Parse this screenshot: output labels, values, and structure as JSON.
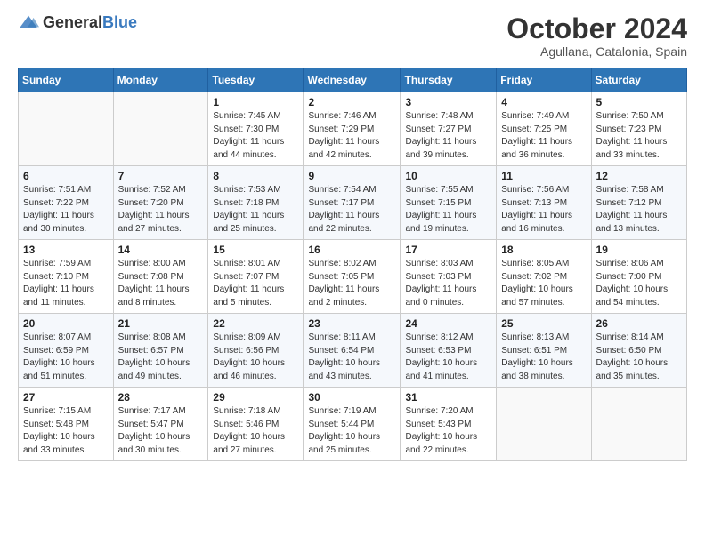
{
  "header": {
    "logo": {
      "text_general": "General",
      "text_blue": "Blue"
    },
    "title": "October 2024",
    "location": "Agullana, Catalonia, Spain"
  },
  "weekdays": [
    "Sunday",
    "Monday",
    "Tuesday",
    "Wednesday",
    "Thursday",
    "Friday",
    "Saturday"
  ],
  "weeks": [
    [
      {
        "day": "",
        "sunrise": "",
        "sunset": "",
        "daylight": ""
      },
      {
        "day": "",
        "sunrise": "",
        "sunset": "",
        "daylight": ""
      },
      {
        "day": "1",
        "sunrise": "Sunrise: 7:45 AM",
        "sunset": "Sunset: 7:30 PM",
        "daylight": "Daylight: 11 hours and 44 minutes."
      },
      {
        "day": "2",
        "sunrise": "Sunrise: 7:46 AM",
        "sunset": "Sunset: 7:29 PM",
        "daylight": "Daylight: 11 hours and 42 minutes."
      },
      {
        "day": "3",
        "sunrise": "Sunrise: 7:48 AM",
        "sunset": "Sunset: 7:27 PM",
        "daylight": "Daylight: 11 hours and 39 minutes."
      },
      {
        "day": "4",
        "sunrise": "Sunrise: 7:49 AM",
        "sunset": "Sunset: 7:25 PM",
        "daylight": "Daylight: 11 hours and 36 minutes."
      },
      {
        "day": "5",
        "sunrise": "Sunrise: 7:50 AM",
        "sunset": "Sunset: 7:23 PM",
        "daylight": "Daylight: 11 hours and 33 minutes."
      }
    ],
    [
      {
        "day": "6",
        "sunrise": "Sunrise: 7:51 AM",
        "sunset": "Sunset: 7:22 PM",
        "daylight": "Daylight: 11 hours and 30 minutes."
      },
      {
        "day": "7",
        "sunrise": "Sunrise: 7:52 AM",
        "sunset": "Sunset: 7:20 PM",
        "daylight": "Daylight: 11 hours and 27 minutes."
      },
      {
        "day": "8",
        "sunrise": "Sunrise: 7:53 AM",
        "sunset": "Sunset: 7:18 PM",
        "daylight": "Daylight: 11 hours and 25 minutes."
      },
      {
        "day": "9",
        "sunrise": "Sunrise: 7:54 AM",
        "sunset": "Sunset: 7:17 PM",
        "daylight": "Daylight: 11 hours and 22 minutes."
      },
      {
        "day": "10",
        "sunrise": "Sunrise: 7:55 AM",
        "sunset": "Sunset: 7:15 PM",
        "daylight": "Daylight: 11 hours and 19 minutes."
      },
      {
        "day": "11",
        "sunrise": "Sunrise: 7:56 AM",
        "sunset": "Sunset: 7:13 PM",
        "daylight": "Daylight: 11 hours and 16 minutes."
      },
      {
        "day": "12",
        "sunrise": "Sunrise: 7:58 AM",
        "sunset": "Sunset: 7:12 PM",
        "daylight": "Daylight: 11 hours and 13 minutes."
      }
    ],
    [
      {
        "day": "13",
        "sunrise": "Sunrise: 7:59 AM",
        "sunset": "Sunset: 7:10 PM",
        "daylight": "Daylight: 11 hours and 11 minutes."
      },
      {
        "day": "14",
        "sunrise": "Sunrise: 8:00 AM",
        "sunset": "Sunset: 7:08 PM",
        "daylight": "Daylight: 11 hours and 8 minutes."
      },
      {
        "day": "15",
        "sunrise": "Sunrise: 8:01 AM",
        "sunset": "Sunset: 7:07 PM",
        "daylight": "Daylight: 11 hours and 5 minutes."
      },
      {
        "day": "16",
        "sunrise": "Sunrise: 8:02 AM",
        "sunset": "Sunset: 7:05 PM",
        "daylight": "Daylight: 11 hours and 2 minutes."
      },
      {
        "day": "17",
        "sunrise": "Sunrise: 8:03 AM",
        "sunset": "Sunset: 7:03 PM",
        "daylight": "Daylight: 11 hours and 0 minutes."
      },
      {
        "day": "18",
        "sunrise": "Sunrise: 8:05 AM",
        "sunset": "Sunset: 7:02 PM",
        "daylight": "Daylight: 10 hours and 57 minutes."
      },
      {
        "day": "19",
        "sunrise": "Sunrise: 8:06 AM",
        "sunset": "Sunset: 7:00 PM",
        "daylight": "Daylight: 10 hours and 54 minutes."
      }
    ],
    [
      {
        "day": "20",
        "sunrise": "Sunrise: 8:07 AM",
        "sunset": "Sunset: 6:59 PM",
        "daylight": "Daylight: 10 hours and 51 minutes."
      },
      {
        "day": "21",
        "sunrise": "Sunrise: 8:08 AM",
        "sunset": "Sunset: 6:57 PM",
        "daylight": "Daylight: 10 hours and 49 minutes."
      },
      {
        "day": "22",
        "sunrise": "Sunrise: 8:09 AM",
        "sunset": "Sunset: 6:56 PM",
        "daylight": "Daylight: 10 hours and 46 minutes."
      },
      {
        "day": "23",
        "sunrise": "Sunrise: 8:11 AM",
        "sunset": "Sunset: 6:54 PM",
        "daylight": "Daylight: 10 hours and 43 minutes."
      },
      {
        "day": "24",
        "sunrise": "Sunrise: 8:12 AM",
        "sunset": "Sunset: 6:53 PM",
        "daylight": "Daylight: 10 hours and 41 minutes."
      },
      {
        "day": "25",
        "sunrise": "Sunrise: 8:13 AM",
        "sunset": "Sunset: 6:51 PM",
        "daylight": "Daylight: 10 hours and 38 minutes."
      },
      {
        "day": "26",
        "sunrise": "Sunrise: 8:14 AM",
        "sunset": "Sunset: 6:50 PM",
        "daylight": "Daylight: 10 hours and 35 minutes."
      }
    ],
    [
      {
        "day": "27",
        "sunrise": "Sunrise: 7:15 AM",
        "sunset": "Sunset: 5:48 PM",
        "daylight": "Daylight: 10 hours and 33 minutes."
      },
      {
        "day": "28",
        "sunrise": "Sunrise: 7:17 AM",
        "sunset": "Sunset: 5:47 PM",
        "daylight": "Daylight: 10 hours and 30 minutes."
      },
      {
        "day": "29",
        "sunrise": "Sunrise: 7:18 AM",
        "sunset": "Sunset: 5:46 PM",
        "daylight": "Daylight: 10 hours and 27 minutes."
      },
      {
        "day": "30",
        "sunrise": "Sunrise: 7:19 AM",
        "sunset": "Sunset: 5:44 PM",
        "daylight": "Daylight: 10 hours and 25 minutes."
      },
      {
        "day": "31",
        "sunrise": "Sunrise: 7:20 AM",
        "sunset": "Sunset: 5:43 PM",
        "daylight": "Daylight: 10 hours and 22 minutes."
      },
      {
        "day": "",
        "sunrise": "",
        "sunset": "",
        "daylight": ""
      },
      {
        "day": "",
        "sunrise": "",
        "sunset": "",
        "daylight": ""
      }
    ]
  ]
}
